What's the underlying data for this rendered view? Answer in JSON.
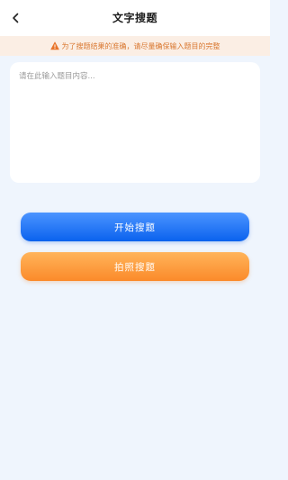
{
  "header": {
    "title": "文字搜题",
    "back_icon": "chevron-left-icon"
  },
  "notice": {
    "icon": "warning-icon",
    "text": "为了搜题结果的准确，请尽量确保输入题目的完整",
    "color": "#d9772f",
    "background": "#fbeee4"
  },
  "input": {
    "placeholder": "请在此输入题目内容...",
    "value": ""
  },
  "buttons": {
    "start_label": "开始搜题",
    "photo_label": "拍照搜题",
    "start_color": "#1a6cf5",
    "photo_color": "#fd9a3e"
  }
}
